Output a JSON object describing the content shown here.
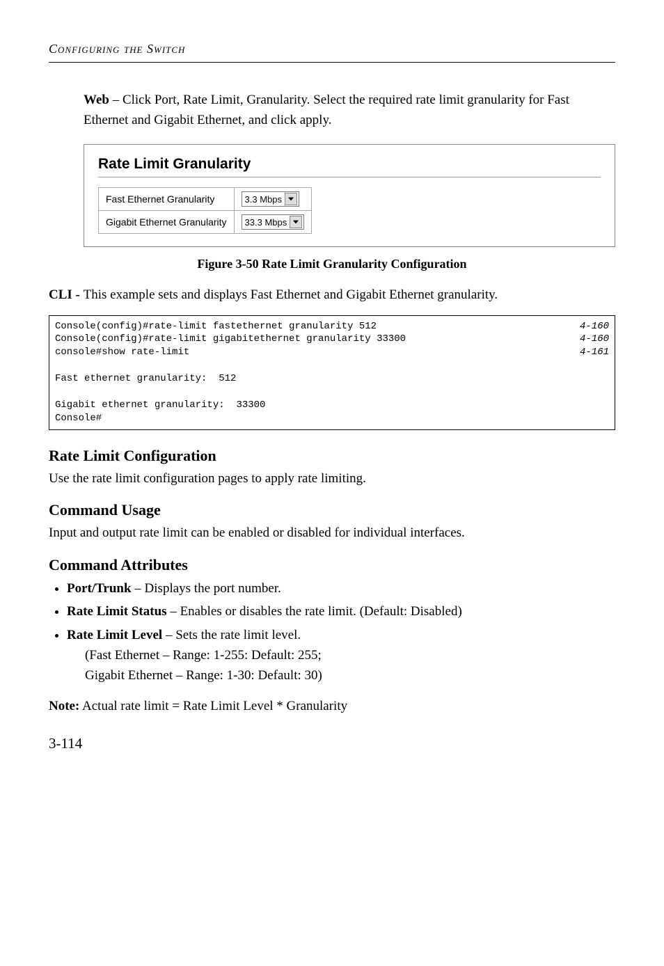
{
  "header": {
    "section_title": "Configuring the Switch"
  },
  "intro": {
    "web_label": "Web",
    "text_after": " – Click Port, Rate Limit, Granularity. Select the required rate limit granularity for Fast Ethernet and Gigabit Ethernet, and click apply."
  },
  "figure": {
    "panel_title": "Rate Limit Granularity",
    "rows": [
      {
        "label": "Fast Ethernet Granularity",
        "value": "3.3 Mbps"
      },
      {
        "label": "Gigabit Ethernet Granularity",
        "value": "33.3 Mbps"
      }
    ],
    "caption": "Figure 3-50  Rate Limit Granularity Configuration"
  },
  "cli": {
    "label": "CLI - ",
    "text": "This example sets and displays Fast Ethernet and Gigabit Ethernet granularity."
  },
  "code": {
    "left": "Console(config)#rate-limit fastethernet granularity 512\nConsole(config)#rate-limit gigabitethernet granularity 33300\nconsole#show rate-limit\n\nFast ethernet granularity:  512\n\nGigabit ethernet granularity:  33300\nConsole#",
    "right": "4-160\n4-160\n4-161\n\n\n\n\n"
  },
  "sections": {
    "rate_limit_config": {
      "heading": "Rate Limit Configuration",
      "body": "Use the rate limit configuration pages to apply rate limiting."
    },
    "command_usage": {
      "heading": "Command Usage",
      "body": "Input and output rate limit can be enabled or disabled for individual interfaces."
    },
    "command_attributes": {
      "heading": "Command Attributes",
      "items": [
        {
          "term": "Port/Trunk",
          "desc": " – Displays the port number."
        },
        {
          "term": "Rate Limit Status",
          "desc": " – Enables or disables the rate limit. (Default: Disabled)"
        },
        {
          "term": "Rate Limit Level",
          "desc": " – Sets the rate limit level."
        }
      ],
      "sublines": [
        "(Fast Ethernet – Range: 1-255: Default: 255;",
        "Gigabit Ethernet – Range: 1-30: Default: 30)"
      ]
    }
  },
  "note": {
    "label": "Note:",
    "text": "  Actual rate limit = Rate Limit Level * Granularity"
  },
  "page_number": "3-114"
}
